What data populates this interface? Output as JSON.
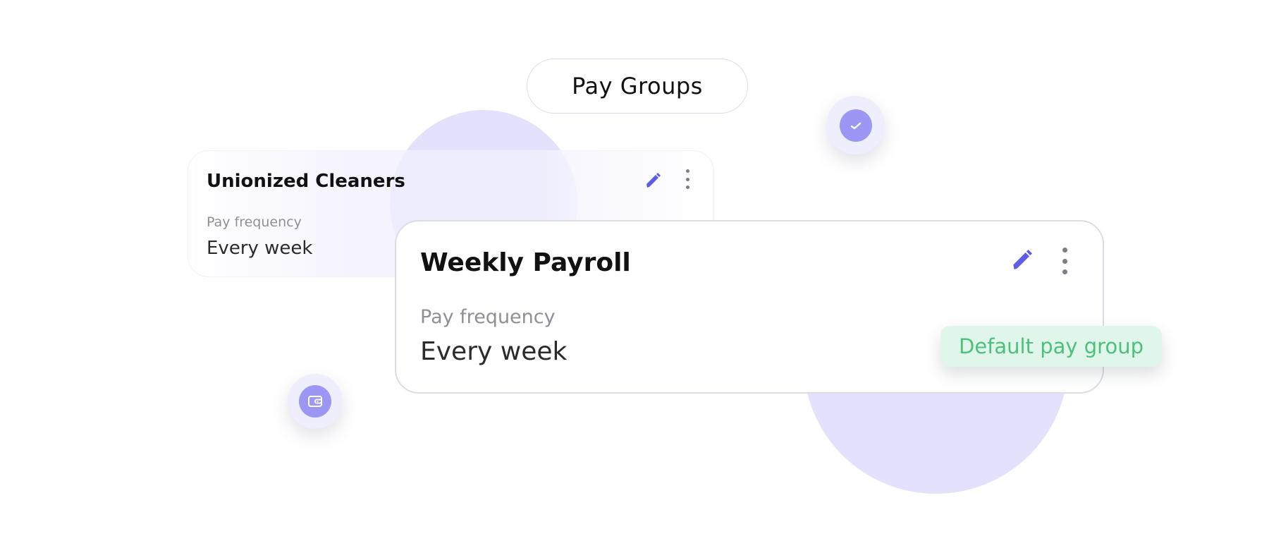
{
  "header": {
    "title": "Pay Groups"
  },
  "cards": [
    {
      "name": "Unionized Cleaners",
      "pay_frequency_label": "Pay frequency",
      "pay_frequency_value": "Every week"
    },
    {
      "name": "Weekly Payroll",
      "pay_frequency_label": "Pay frequency",
      "pay_frequency_value": "Every week",
      "badge": "Default pay group"
    }
  ],
  "icons": {
    "edit": "pencil-icon",
    "more": "more-vertical-icon",
    "check": "check-icon",
    "wallet": "wallet-icon"
  },
  "colors": {
    "accent": "#5e5ce6",
    "accent_soft": "#9c97f4",
    "blob": "#e3e1fb",
    "badge_bg": "#e1f6ea",
    "badge_text": "#4cc07c",
    "muted_text": "#8f8f97"
  }
}
